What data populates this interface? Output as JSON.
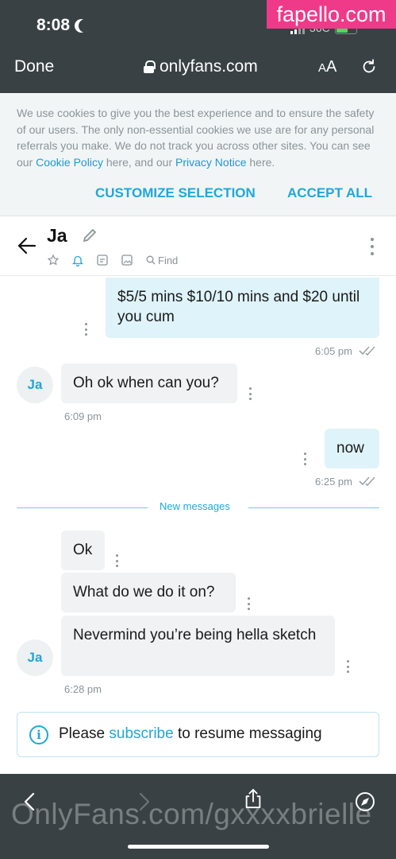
{
  "status_bar": {
    "time": "8:08",
    "right_text": "36C"
  },
  "watermark_top": "fapello.com",
  "browser": {
    "done_label": "Done",
    "url": "onlyfans.com",
    "text_size_label_small": "A",
    "text_size_label_large": "A"
  },
  "cookie_banner": {
    "text_before": "We use cookies to give you the best experience and to ensure the safety of our users. The only non-essential cookies we use are for any personal referrals you make. We do not track you across other sites. You can see our ",
    "cookie_policy_link": "Cookie Policy",
    "text_middle": " here, and our ",
    "privacy_link": "Privacy Notice",
    "text_after": " here.",
    "customize_label": "CUSTOMIZE SELECTION",
    "accept_label": "ACCEPT ALL"
  },
  "chat": {
    "name": "Ja",
    "find_label": "Find",
    "avatar_initials": "Ja",
    "messages": [
      {
        "text": "$5/5 mins $10/10 mins and $20 until you cum",
        "time": "6:05 pm"
      },
      {
        "text": "Oh ok when can you?",
        "time": "6:09 pm"
      },
      {
        "text": "now",
        "time": "6:25 pm"
      },
      {
        "text": "Ok"
      },
      {
        "text": "What do we do it on?"
      },
      {
        "text": "Nevermind you’re being hella sketch",
        "time": "6:28 pm"
      }
    ],
    "new_messages_label": "New messages",
    "notice": {
      "before": "Please ",
      "link": "subscribe",
      "after": " to resume messaging",
      "icon": "i"
    }
  },
  "watermark_bottom": "OnlyFans.com/gxxxxbrielle",
  "colors": {
    "accent": "#1ea8d9",
    "bar": "#3a4145",
    "outgoing": "#dff3fa",
    "incoming": "#f0f2f3",
    "watermark": "#ef3a89"
  }
}
